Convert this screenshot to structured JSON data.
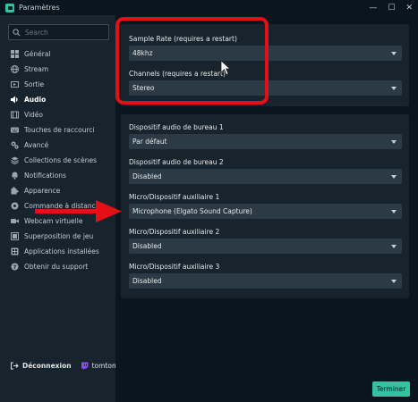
{
  "window": {
    "title": "Paramètres",
    "controls": [
      "—",
      "☐",
      "✕"
    ]
  },
  "search": {
    "placeholder": "Search"
  },
  "sidebar": {
    "items": [
      {
        "label": "Général",
        "icon": "grid-icon"
      },
      {
        "label": "Stream",
        "icon": "globe-icon"
      },
      {
        "label": "Sortie",
        "icon": "output-icon"
      },
      {
        "label": "Audio",
        "icon": "speaker-icon",
        "active": true
      },
      {
        "label": "Vidéo",
        "icon": "film-icon"
      },
      {
        "label": "Touches de raccourci",
        "icon": "keyboard-icon"
      },
      {
        "label": "Avancé",
        "icon": "gears-icon"
      },
      {
        "label": "Collections de scènes",
        "icon": "layers-icon"
      },
      {
        "label": "Notifications",
        "icon": "bell-icon"
      },
      {
        "label": "Apparence",
        "icon": "puzzle-icon"
      },
      {
        "label": "Commande à distance",
        "icon": "remote-icon"
      },
      {
        "label": "Webcam virtuelle",
        "icon": "camera-icon"
      },
      {
        "label": "Superposition de jeu",
        "icon": "overlay-icon"
      },
      {
        "label": "Applications installées",
        "icon": "apps-icon"
      },
      {
        "label": "Obtenir du support",
        "icon": "help-icon"
      }
    ]
  },
  "account": {
    "logout_label": "Déconnexion",
    "username": "tomtom"
  },
  "panel1": {
    "sample_rate": {
      "label": "Sample Rate (requires a restart)",
      "value": "48khz"
    },
    "channels": {
      "label": "Channels (requires a restart)",
      "value": "Stereo"
    }
  },
  "panel2": {
    "fields": [
      {
        "label": "Dispositif audio de bureau 1",
        "value": "Par défaut"
      },
      {
        "label": "Dispositif audio de bureau 2",
        "value": "Disabled"
      },
      {
        "label": "Micro/Dispositif auxiliaire 1",
        "value": "Microphone (Elgato Sound Capture)"
      },
      {
        "label": "Micro/Dispositif auxiliaire 2",
        "value": "Disabled"
      },
      {
        "label": "Micro/Dispositif auxiliaire 3",
        "value": "Disabled"
      }
    ]
  },
  "footer": {
    "done_label": "Terminer"
  },
  "colors": {
    "accent": "#31c3a2",
    "annotation": "#e41018"
  }
}
